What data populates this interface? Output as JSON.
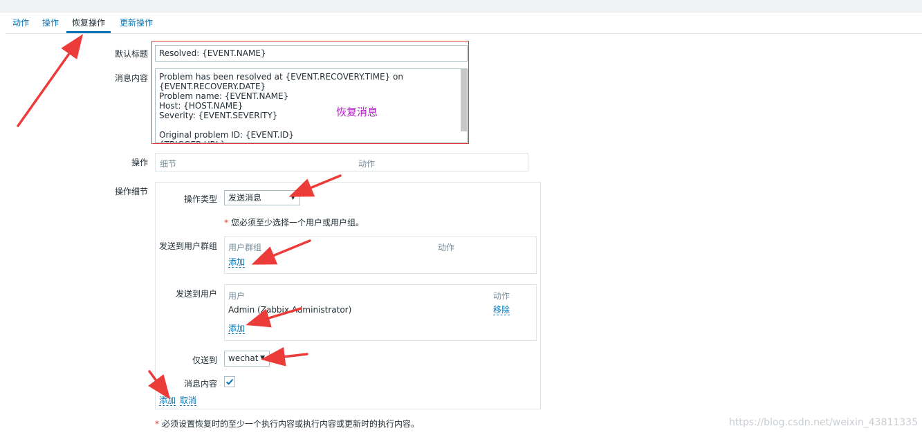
{
  "tabs": [
    "动作",
    "操作",
    "恢复操作",
    "更新操作"
  ],
  "form": {
    "subject_label": "默认标题",
    "subject_value": "Resolved: {EVENT.NAME}",
    "message_label": "消息内容",
    "message_value": "Problem has been resolved at {EVENT.RECOVERY.TIME} on\n{EVENT.RECOVERY.DATE}\nProblem name: {EVENT.NAME}\nHost: {HOST.NAME}\nSeverity: {EVENT.SEVERITY}\n\nOriginal problem ID: {EVENT.ID}\n{TRIGGER.URL}",
    "message_annotation": "恢复消息",
    "operations_label": "操作",
    "operations_col_details": "细节",
    "operations_col_action": "动作",
    "details_label": "操作细节"
  },
  "details": {
    "type_label": "操作类型",
    "type_value": "发送消息",
    "required_note": "您必须至少选择一个用户或用户组。",
    "groups_label": "发送到用户群组",
    "groups_col_group": "用户群组",
    "groups_col_action": "动作",
    "groups_add": "添加",
    "users_label": "发送到用户",
    "users_col_user": "用户",
    "users_col_action": "动作",
    "users_row_name": "Admin (Zabbix Administrator)",
    "users_row_remove": "移除",
    "users_add": "添加",
    "sendonly_label": "仅送到",
    "sendonly_value": "wechat",
    "msgcontent_label": "消息内容",
    "msgcontent_checked": true,
    "add_link": "添加",
    "cancel_link": "取消"
  },
  "footer_note": "必须设置恢复时的至少一个执行内容或执行内容或更新时的执行内容。",
  "watermark": "https://blog.csdn.net/weixin_43811335",
  "colors": {
    "accent": "#0275b8",
    "annotation_red": "#e3373a",
    "annotation_purple": "#b521c7"
  }
}
